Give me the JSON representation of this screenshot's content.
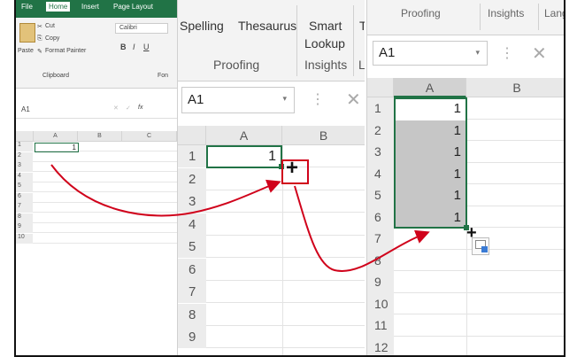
{
  "panel1": {
    "tabs": [
      "File",
      "Home",
      "Insert",
      "Page Layout"
    ],
    "clipboard": {
      "cut": "Cut",
      "copy": "Copy",
      "paste": "Paste",
      "format_painter": "Format Painter",
      "group": "Clipboard",
      "font_group": "Fon",
      "font_name": "Calibri",
      "bold": "B",
      "italic": "I",
      "underline": "U"
    },
    "name_box": "A1",
    "fx": "fx",
    "columns": [
      "A",
      "B",
      "C"
    ],
    "rows": [
      "1",
      "2",
      "3",
      "4",
      "5",
      "6",
      "7",
      "8",
      "9",
      "10"
    ],
    "cell_a1": "1"
  },
  "panel2": {
    "ribbon": {
      "spelling": "Spelling",
      "thesaurus": "Thesaurus",
      "smart": "Smart",
      "lookup": "Lookup",
      "tr": "Tr",
      "proofing": "Proofing",
      "insights": "Insights",
      "la": "La"
    },
    "name_box": "A1",
    "columns": [
      "A",
      "B"
    ],
    "rows": [
      "1",
      "2",
      "3",
      "4",
      "5",
      "6",
      "7",
      "8",
      "9"
    ],
    "cell_a1": "1"
  },
  "panel3": {
    "ribbon": {
      "proofing": "Proofing",
      "insights": "Insights",
      "lang": "Lang"
    },
    "name_box": "A1",
    "columns": [
      "A",
      "B"
    ],
    "rows": [
      "1",
      "2",
      "3",
      "4",
      "5",
      "6",
      "7",
      "8",
      "9",
      "10",
      "11",
      "12"
    ],
    "values": [
      "1",
      "1",
      "1",
      "1",
      "1",
      "1"
    ]
  },
  "colors": {
    "excel_green": "#217346",
    "selection_fill": "#c6c6c6",
    "arrow_red": "#d0021b"
  }
}
